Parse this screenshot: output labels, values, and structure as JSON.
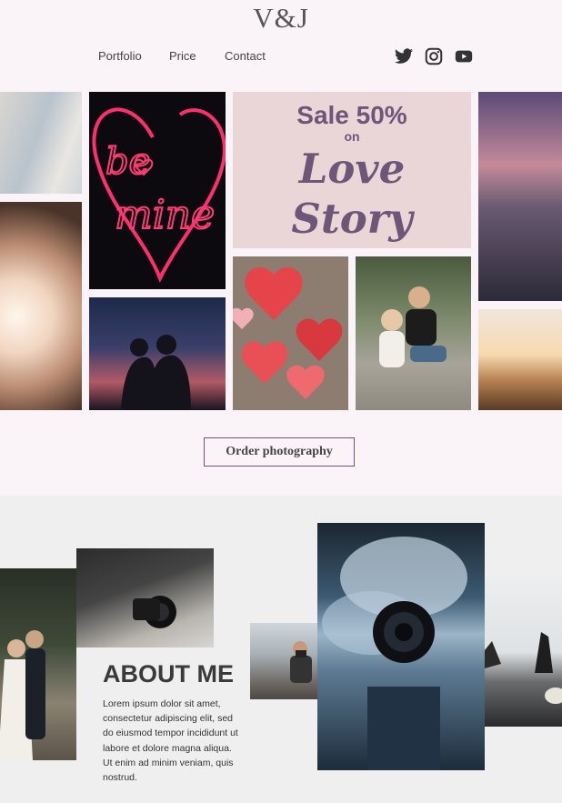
{
  "header": {
    "logo": "V&J",
    "nav": [
      {
        "label": "Portfolio"
      },
      {
        "label": "Price"
      },
      {
        "label": "Contact"
      }
    ],
    "social": [
      "twitter-icon",
      "instagram-icon",
      "youtube-icon"
    ]
  },
  "banner": {
    "line1": "Sale 50%",
    "line2": "on",
    "line3": "Love",
    "line4": "Story"
  },
  "cta": {
    "order_label": "Order photography"
  },
  "about": {
    "title": "ABOUT ME",
    "body": "Lorem ipsum dolor sit amet, consectetur adipiscing elit, sed do eiusmod tempor incididunt ut labore et dolore magna aliqua. Ut enim ad minim veniam, quis nostrud."
  },
  "colors": {
    "page_bg": "#faf3f7",
    "accent": "#6d5678",
    "banner_bg": "#ead6d6",
    "section_bg": "#efefef"
  }
}
